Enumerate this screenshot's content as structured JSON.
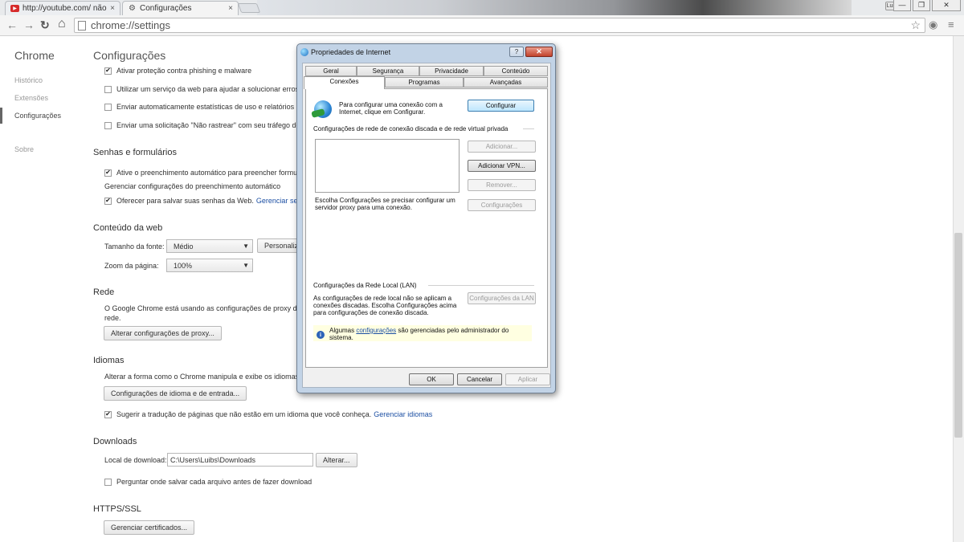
{
  "browser": {
    "tabs": [
      {
        "label": "http://youtube.com/ não (",
        "icon": "youtube-icon",
        "close": "×"
      },
      {
        "label": "Configurações",
        "icon": "gear-icon",
        "close": "×"
      }
    ],
    "profile_badge": "Luibs",
    "window_controls": {
      "minimize": "—",
      "restore": "❐",
      "close": "✕"
    },
    "address": "chrome://settings",
    "nav": {
      "back": "←",
      "forward": "→",
      "reload": "↻",
      "home": "⌂"
    }
  },
  "sidebar": {
    "title": "Chrome",
    "items": [
      "Histórico",
      "Extensões",
      "Configurações",
      "Sobre"
    ]
  },
  "main": {
    "title": "Configurações",
    "privacy": {
      "items": [
        {
          "label": "Ativar proteção contra phishing e malware",
          "checked": true
        },
        {
          "label": "Utilizar um serviço da web para ajudar a solucionar erros",
          "checked": false
        },
        {
          "label": "Enviar automaticamente estatísticas de uso e relatórios d",
          "checked": false
        },
        {
          "label": "Enviar uma solicitação \"Não rastrear\" com seu tráfego de",
          "checked": false
        }
      ]
    },
    "passwords": {
      "title": "Senhas e formulários",
      "autofill": "Ative o preenchimento automático para preencher formu",
      "manage_autofill": "Gerenciar configurações do preenchimento automático",
      "save_passwords": "Oferecer para salvar suas senhas da Web.",
      "manage_passwords": "Gerenciar senh"
    },
    "web_content": {
      "title": "Conteúdo da web",
      "font_size_label": "Tamanho da fonte:",
      "font_size_value": "Médio",
      "customize": "Personaliza",
      "zoom_label": "Zoom da página:",
      "zoom_value": "100%"
    },
    "network": {
      "title": "Rede",
      "desc1": "O Google Chrome está usando as configurações de proxy do",
      "desc2": "rede.",
      "button": "Alterar configurações de proxy..."
    },
    "languages": {
      "title": "Idiomas",
      "desc": "Alterar a forma como o Chrome manipula e exibe os idiomas",
      "button": "Configurações de idioma e de entrada...",
      "translate": "Sugerir a tradução de páginas que não estão em um idioma que você conheça.",
      "manage": "Gerenciar idiomas"
    },
    "downloads": {
      "title": "Downloads",
      "location_label": "Local de download:",
      "location_value": "C:\\Users\\Luibs\\Downloads",
      "change_button": "Alterar...",
      "ask": "Perguntar onde salvar cada arquivo antes de fazer download"
    },
    "https": {
      "title": "HTTPS/SSL",
      "button": "Gerenciar certificados..."
    }
  },
  "dialog": {
    "title": "Propriedades de Internet",
    "help": "?",
    "close": "✕",
    "tabs_row1": [
      "Geral",
      "Segurança",
      "Privacidade",
      "Conteúdo"
    ],
    "tabs_row2": [
      "Conexões",
      "Programas",
      "Avançadas"
    ],
    "setup_text": "Para configurar uma conexão com a Internet, clique em Configurar.",
    "setup_button": "Configurar",
    "dialup_heading": "Configurações de rede de conexão discada e de rede virtual privada",
    "add": "Adicionar...",
    "add_vpn": "Adicionar VPN...",
    "remove": "Remover...",
    "settings": "Configurações",
    "proxy_hint": "Escolha Configurações se precisar configurar um servidor proxy para uma conexão.",
    "lan_heading": "Configurações da Rede Local (LAN)",
    "lan_text": "As configurações de rede local não se aplicam a conexões discadas. Escolha Configurações acima para configurações de conexão discada.",
    "lan_button": "Configurações da LAN",
    "admin_prefix": "Algumas",
    "admin_link": "configurações",
    "admin_suffix": "são gerenciadas pelo administrador do",
    "admin_suffix2": "sistema.",
    "info_icon": "i",
    "ok": "OK",
    "cancel": "Cancelar",
    "apply": "Aplicar"
  }
}
